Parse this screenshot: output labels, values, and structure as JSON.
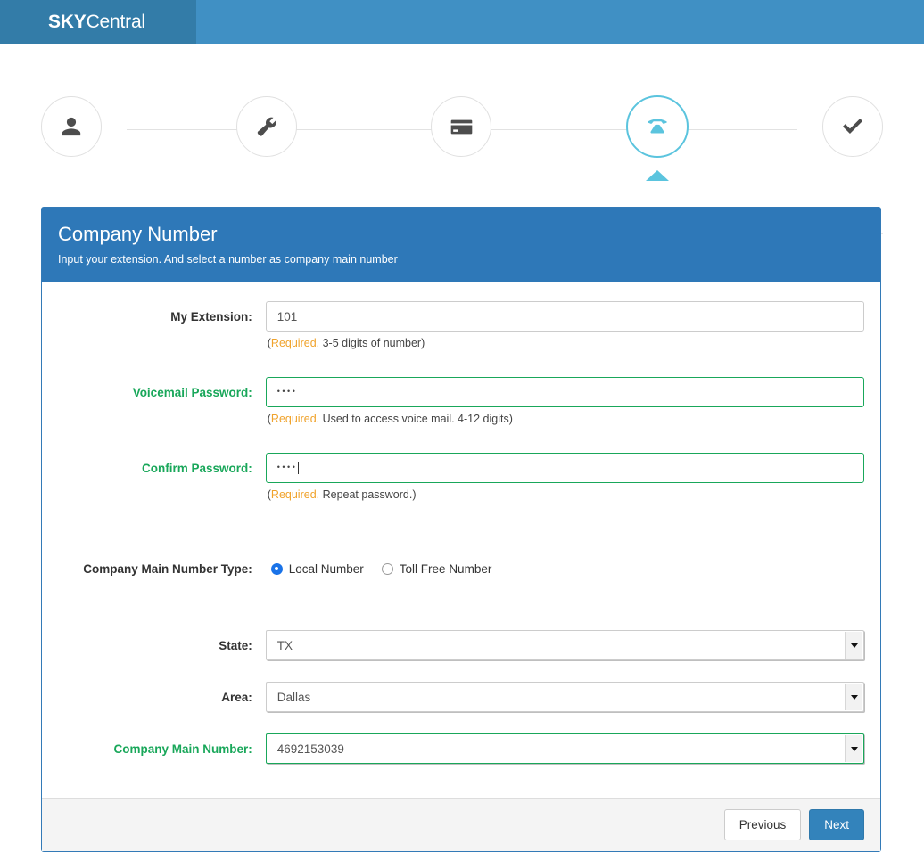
{
  "brand": {
    "strong": "SKY",
    "light": "Central"
  },
  "colors": {
    "topbar": "#4090c4",
    "brand_block": "#337ca8",
    "panel_header": "#2e78b8",
    "accent_active_step": "#5bc4de",
    "valid_green": "#19a75a",
    "required_orange": "#f0a32c",
    "primary_button": "#3383bb"
  },
  "stepper": {
    "steps": [
      {
        "icon": "user-icon",
        "state": "done"
      },
      {
        "icon": "wrench-icon",
        "state": "done"
      },
      {
        "icon": "credit-card-icon",
        "state": "done"
      },
      {
        "icon": "phone-icon",
        "state": "active"
      },
      {
        "icon": "check-icon",
        "state": "done"
      }
    ]
  },
  "panel": {
    "title": "Company Number",
    "subtitle": "Input your extension. And select a number as company main number"
  },
  "form": {
    "extension": {
      "label": "My Extension:",
      "value": "101",
      "placeholder": "",
      "hint_required": "Required.",
      "hint_rest": " 3-5 digits of number)",
      "hint_open": "(",
      "valid": false
    },
    "voicemail_password": {
      "label": "Voicemail Password:",
      "value": "••••",
      "masked_length": 4,
      "hint_open": "(",
      "hint_required": "Required.",
      "hint_rest": " Used to access voice mail. 4-12 digits)",
      "valid": true
    },
    "confirm_password": {
      "label": "Confirm Password:",
      "value": "••••",
      "masked_length": 4,
      "hint_open": "(",
      "hint_required": "Required.",
      "hint_rest": " Repeat password.)",
      "valid": true,
      "focused": true
    },
    "number_type": {
      "label": "Company Main Number Type:",
      "options": [
        {
          "label": "Local Number",
          "selected": true
        },
        {
          "label": "Toll Free Number",
          "selected": false
        }
      ]
    },
    "state": {
      "label": "State:",
      "value": "TX",
      "valid": false
    },
    "area": {
      "label": "Area:",
      "value": "Dallas",
      "valid": false
    },
    "main_number": {
      "label": "Company Main Number:",
      "value": "4692153039",
      "valid": true
    }
  },
  "footer": {
    "previous_label": "Previous",
    "next_label": "Next"
  }
}
